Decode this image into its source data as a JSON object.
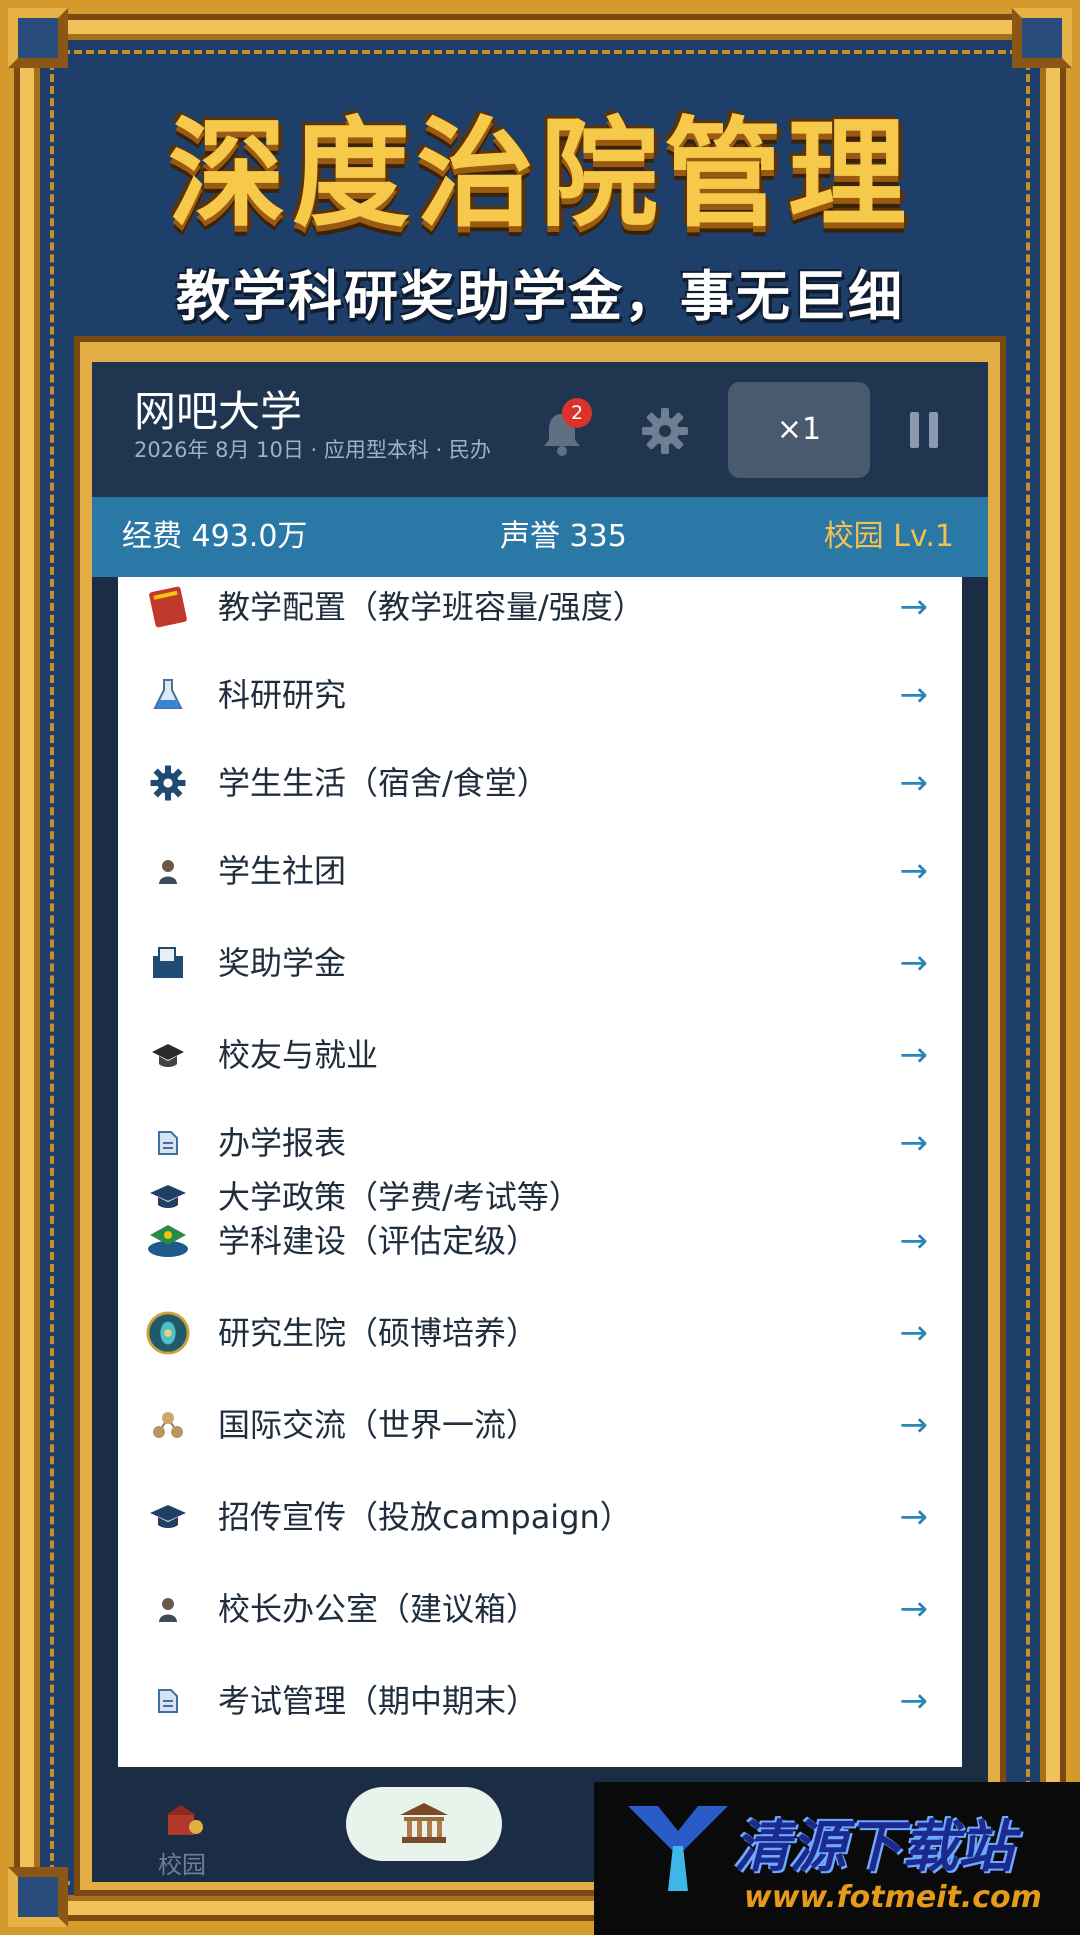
{
  "banner": {
    "title": "深度治院管理",
    "subtitle": "教学科研奖助学金，事无巨细"
  },
  "header": {
    "university_name": "网吧大学",
    "meta": "2026年 8月 10日 · 应用型本科 · 民办",
    "notification_count": "2",
    "speed_label": "×1"
  },
  "stats": {
    "funds": "经费 493.0万",
    "reputation": "声誉 335",
    "campus_level": "校园 Lv.1"
  },
  "menu": {
    "arrow": "→",
    "items": [
      {
        "label": "教学配置（教学班容量/强度）",
        "icon": "book-icon"
      },
      {
        "label": "科研研究",
        "icon": "flask-icon"
      },
      {
        "label": "学生生活（宿舍/食堂）",
        "icon": "gear-icon"
      },
      {
        "label": "学生社团",
        "icon": "person-icon"
      },
      {
        "label": "奖助学金",
        "icon": "document-icon"
      },
      {
        "label": "校友与就业",
        "icon": "graduation-cap-icon"
      },
      {
        "label": "办学报表",
        "icon": "report-icon"
      },
      {
        "label": "大学政策（学费/考试等）",
        "icon": "mortarboard-icon"
      },
      {
        "label": "学科建设（评估定级）",
        "icon": "cap-badge-icon"
      },
      {
        "label": "研究生院（硕博培养）",
        "icon": "globe-gem-icon"
      },
      {
        "label": "国际交流（世界一流）",
        "icon": "network-icon"
      },
      {
        "label": "招传宣传（投放campaign）",
        "icon": "mortarboard-icon"
      },
      {
        "label": "校长办公室（建议箱）",
        "icon": "person-icon"
      },
      {
        "label": "考试管理（期中期末）",
        "icon": "report-icon"
      }
    ]
  },
  "bottom_nav": {
    "campus_label": "校园"
  },
  "watermark": {
    "title": "清源下载站",
    "url": "www.fotmeit.com"
  },
  "colors": {
    "accent": "#2a78a6",
    "gold": "#f2c14e",
    "arrow": "#2a86b5",
    "badge": "#d9342b"
  }
}
